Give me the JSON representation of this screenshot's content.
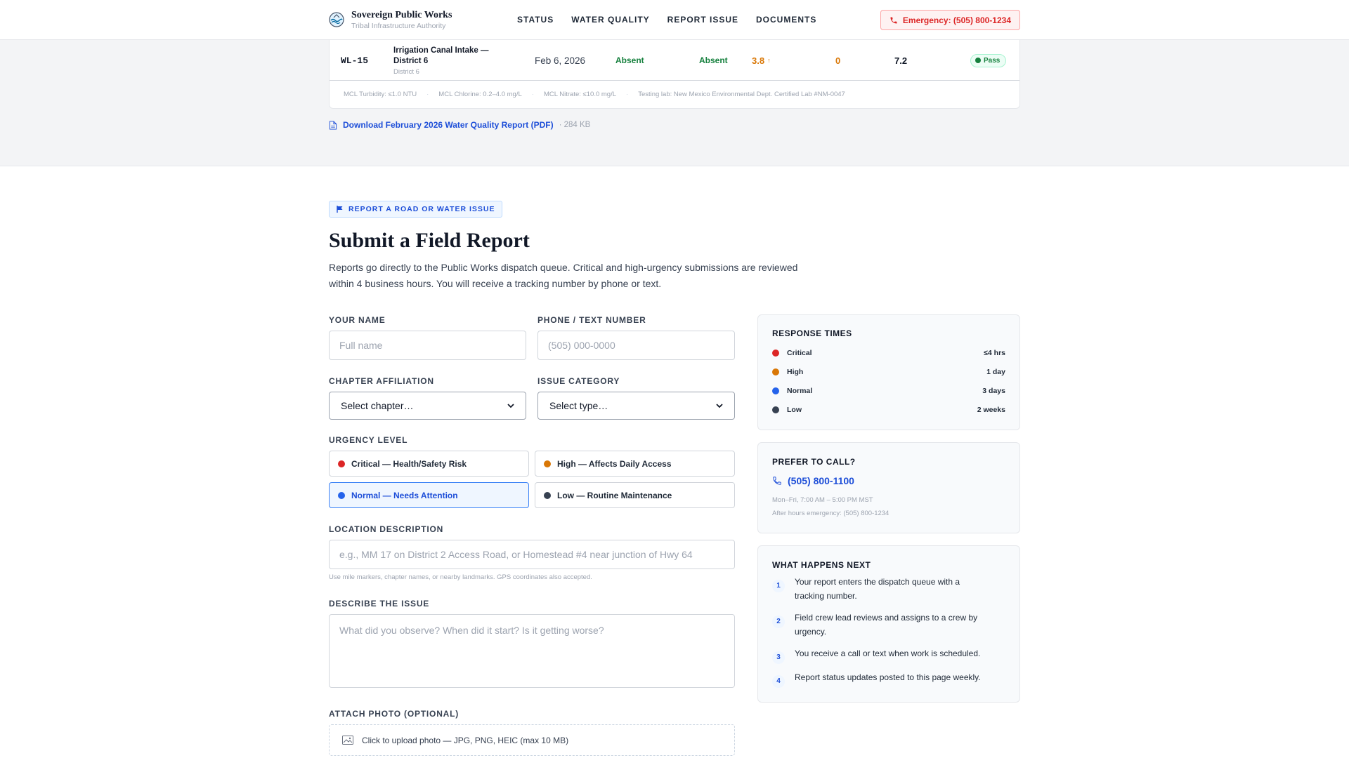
{
  "header": {
    "brand_name": "Sovereign Public Works",
    "brand_sub": "Tribal Infrastructure Authority",
    "nav": [
      "STATUS",
      "WATER QUALITY",
      "REPORT ISSUE",
      "DOCUMENTS"
    ],
    "emergency": "Emergency: (505) 800-1234"
  },
  "water_table": {
    "row": {
      "site_id": "WL-15",
      "location": "Irrigation Canal Intake — District 6",
      "location_sub": "District 6",
      "date": "Feb 6, 2026",
      "coliform": "Absent",
      "ecoli": "Absent",
      "chlorine": "3.8",
      "chlorine_trend": "↑",
      "nitrate": "0",
      "ph": "7.2",
      "status": "Pass"
    },
    "notes": [
      "MCL Turbidity: ≤1.0 NTU",
      "MCL Chlorine: 0.2–4.0 mg/L",
      "MCL Nitrate: ≤10.0 mg/L",
      "Testing lab: New Mexico Environmental Dept. Certified Lab #NM-0047"
    ],
    "note_sep": "·",
    "download_label": "Download February 2026 Water Quality Report (PDF)",
    "download_size": "· 284 KB"
  },
  "report": {
    "tag": "REPORT A ROAD OR WATER ISSUE",
    "title": "Submit a Field Report",
    "intro": "Reports go directly to the Public Works dispatch queue. Critical and high-urgency submissions are reviewed within 4 business hours. You will receive a tracking number by phone or text.",
    "name_label": "YOUR NAME",
    "name_placeholder": "Full name",
    "phone_label": "PHONE / TEXT NUMBER",
    "phone_placeholder": "(505) 000-0000",
    "chapter_label": "CHAPTER AFFILIATION",
    "chapter_value": "Select chapter…",
    "category_label": "ISSUE CATEGORY",
    "category_value": "Select type…",
    "urgency_label": "URGENCY LEVEL",
    "urgency": [
      {
        "label": "Critical — Health/Safety Risk",
        "color": "#dc2626"
      },
      {
        "label": "High — Affects Daily Access",
        "color": "#d97706"
      },
      {
        "label": "Normal — Needs Attention",
        "color": "#2563eb"
      },
      {
        "label": "Low — Routine Maintenance",
        "color": "#374151"
      }
    ],
    "location_label": "LOCATION DESCRIPTION",
    "location_placeholder": "e.g., MM 17 on District 2 Access Road, or Homestead #4 near junction of Hwy 64",
    "location_hint": "Use mile markers, chapter names, or nearby landmarks. GPS coordinates also accepted.",
    "describe_label": "DESCRIBE THE ISSUE",
    "describe_placeholder": "What did you observe? When did it start? Is it getting worse?",
    "photo_label": "ATTACH PHOTO (OPTIONAL)",
    "photo_text": "Click to upload photo — JPG, PNG, HEIC (max 10 MB)"
  },
  "sidebar": {
    "response_title": "RESPONSE TIMES",
    "response_times": [
      {
        "level": "Critical",
        "time": "≤4 hrs",
        "color": "#dc2626"
      },
      {
        "level": "High",
        "time": "1 day",
        "color": "#d97706"
      },
      {
        "level": "Normal",
        "time": "3 days",
        "color": "#2563eb"
      },
      {
        "level": "Low",
        "time": "2 weeks",
        "color": "#374151"
      }
    ],
    "call_title": "PREFER TO CALL?",
    "call_phone": "(505) 800-1100",
    "call_hours": "Mon–Fri, 7:00 AM – 5:00 PM MST",
    "call_after": "After hours emergency: (505) 800-1234",
    "next_title": "WHAT HAPPENS NEXT",
    "steps": [
      {
        "num": "1",
        "text": "Your report enters the dispatch queue with a tracking number."
      },
      {
        "num": "2",
        "text": "Field crew lead reviews and assigns to a crew by urgency."
      },
      {
        "num": "3",
        "text": "You receive a call or text when work is scheduled."
      },
      {
        "num": "4",
        "text": "Report status updates posted to this page weekly."
      }
    ]
  },
  "colors": {
    "accent": "#1d4ed8",
    "danger": "#dc2626",
    "warning": "#d97706",
    "success": "#15803d"
  }
}
